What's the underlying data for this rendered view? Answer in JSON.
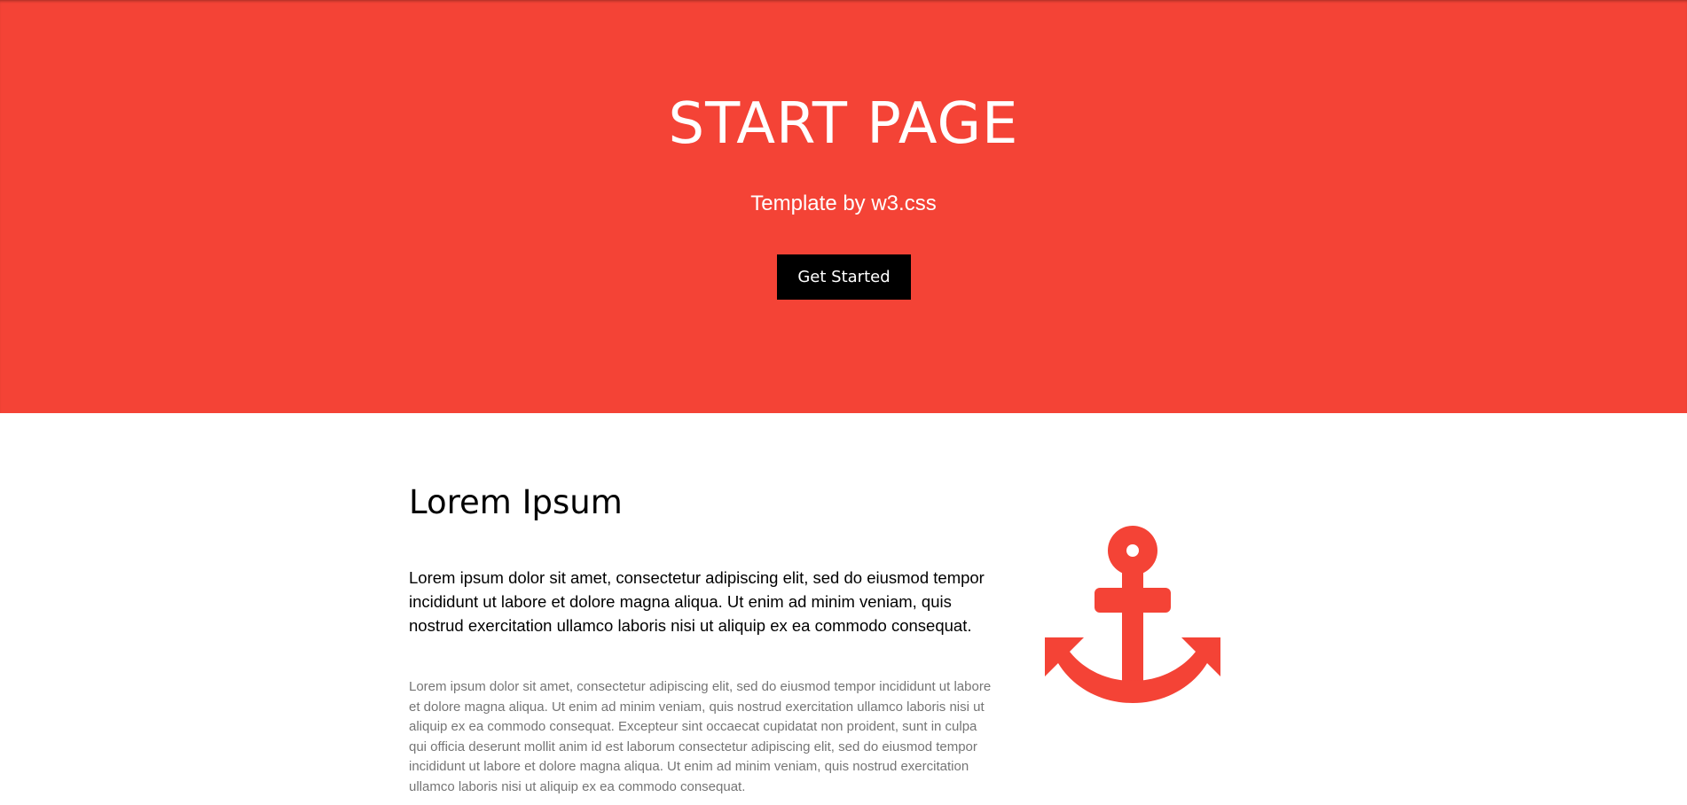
{
  "colors": {
    "accent": "#f44336",
    "button_bg": "#000000",
    "muted_text": "#757575"
  },
  "hero": {
    "title": "START PAGE",
    "subtitle": "Template by w3.css",
    "cta_label": "Get Started"
  },
  "section": {
    "title": "Lorem Ipsum",
    "lead": "Lorem ipsum dolor sit amet, consectetur adipiscing elit, sed do eiusmod tempor incididunt ut labore et dolore magna aliqua. Ut enim ad minim veniam, quis nostrud exercitation ullamco laboris nisi ut aliquip ex ea commodo consequat.",
    "body": "Lorem ipsum dolor sit amet, consectetur adipiscing elit, sed do eiusmod tempor incididunt ut labore et dolore magna aliqua. Ut enim ad minim veniam, quis nostrud exercitation ullamco laboris nisi ut aliquip ex ea commodo consequat. Excepteur sint occaecat cupidatat non proident, sunt in culpa qui officia deserunt mollit anim id est laborum consectetur adipiscing elit, sed do eiusmod tempor incididunt ut labore et dolore magna aliqua. Ut enim ad minim veniam, quis nostrud exercitation ullamco laboris nisi ut aliquip ex ea commodo consequat.",
    "icon": "anchor-icon"
  }
}
